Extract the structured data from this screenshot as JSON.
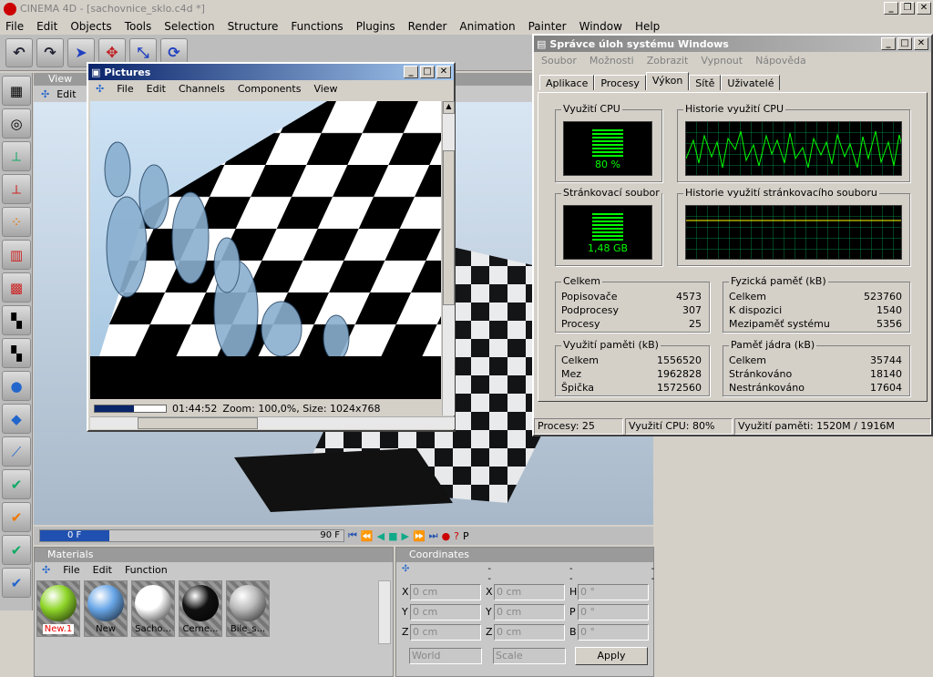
{
  "app": {
    "title": "CINEMA 4D - [sachovnice_sklo.c4d *]"
  },
  "menu": [
    "File",
    "Edit",
    "Objects",
    "Tools",
    "Selection",
    "Structure",
    "Functions",
    "Plugins",
    "Render",
    "Animation",
    "Painter",
    "Window",
    "Help"
  ],
  "viewport": {
    "label": "View",
    "menu": [
      "Edit"
    ]
  },
  "pictures": {
    "title": "Pictures",
    "menu": [
      "File",
      "Edit",
      "Channels",
      "Components",
      "View"
    ],
    "time": "01:44:52",
    "status": "Zoom: 100,0%, Size: 1024x768",
    "progress": 0.55
  },
  "timeline": {
    "start": "0 F",
    "end": "90 F"
  },
  "materials": {
    "title": "Materials",
    "menu": [
      "File",
      "Edit",
      "Function"
    ],
    "items": [
      {
        "label": "New.1",
        "color": "#8fd62a"
      },
      {
        "label": "New",
        "color": "#6aa7e8"
      },
      {
        "label": "Sacho...",
        "color": "#ffffff"
      },
      {
        "label": "Cerne...",
        "color": "#111111"
      },
      {
        "label": "Bile_s...",
        "color": "#bbbbbb"
      }
    ]
  },
  "coords": {
    "title": "Coordinates",
    "dashes": [
      "--",
      "--",
      "--"
    ],
    "rows": [
      [
        "X",
        "0 cm",
        "X",
        "0 cm",
        "H",
        "0 °"
      ],
      [
        "Y",
        "0 cm",
        "Y",
        "0 cm",
        "P",
        "0 °"
      ],
      [
        "Z",
        "0 cm",
        "Z",
        "0 cm",
        "B",
        "0 °"
      ]
    ],
    "world": "World",
    "scale": "Scale",
    "apply": "Apply"
  },
  "taskman": {
    "title": "Správce úloh systému Windows",
    "menu": [
      "Soubor",
      "Možnosti",
      "Zobrazit",
      "Vypnout",
      "Nápověda"
    ],
    "tabs": [
      "Aplikace",
      "Procesy",
      "Výkon",
      "Sítě",
      "Uživatelé"
    ],
    "active_tab": "Výkon",
    "cpu_label": "Využití CPU",
    "cpu_value": "80 %",
    "cpu_hist_label": "Historie využití CPU",
    "pf_label": "Stránkovací soubor",
    "pf_value": "1,48 GB",
    "pf_hist_label": "Historie využití stránkovacího souboru",
    "totals": {
      "title": "Celkem",
      "rows": [
        [
          "Popisovače",
          "4573"
        ],
        [
          "Podprocesy",
          "307"
        ],
        [
          "Procesy",
          "25"
        ]
      ]
    },
    "physical": {
      "title": "Fyzická paměť (kB)",
      "rows": [
        [
          "Celkem",
          "523760"
        ],
        [
          "K dispozici",
          "1540"
        ],
        [
          "Mezipaměť systému",
          "5356"
        ]
      ]
    },
    "commit": {
      "title": "Využití paměti (kB)",
      "rows": [
        [
          "Celkem",
          "1556520"
        ],
        [
          "Mez",
          "1962828"
        ],
        [
          "Špička",
          "1572560"
        ]
      ]
    },
    "kernel": {
      "title": "Paměť jádra (kB)",
      "rows": [
        [
          "Celkem",
          "35744"
        ],
        [
          "Stránkováno",
          "18140"
        ],
        [
          "Nestránkováno",
          "17604"
        ]
      ]
    },
    "status": [
      "Procesy: 25",
      "Využití CPU: 80%",
      "Využití paměti: 1520M / 1916M"
    ]
  },
  "colors": {
    "monitor_green": "#00ff00",
    "title_blue": "#0a246a"
  }
}
